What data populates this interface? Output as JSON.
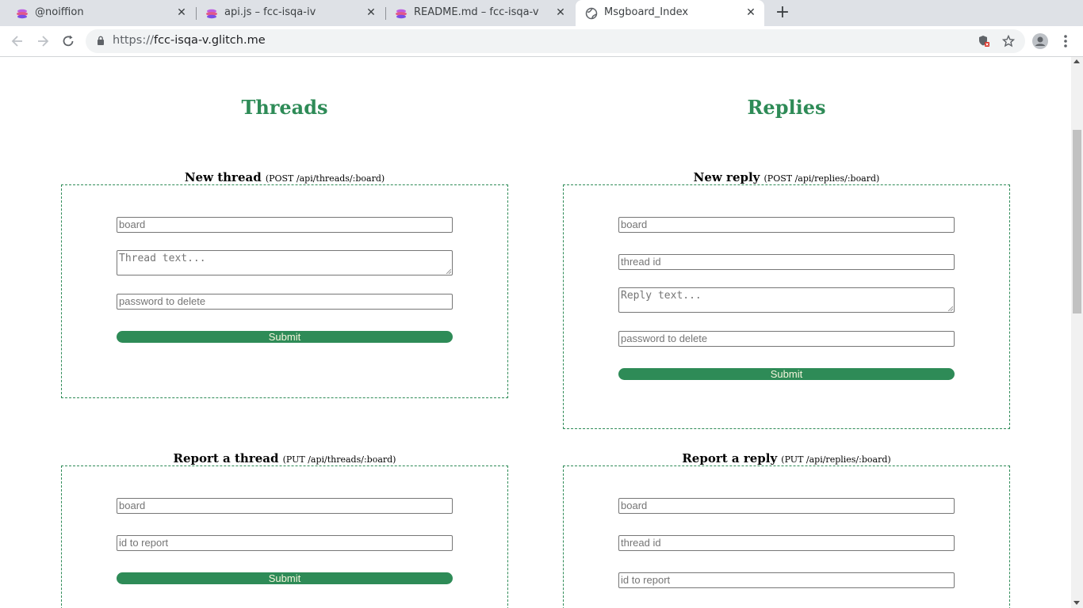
{
  "browser": {
    "tabs": [
      {
        "title": "@noiffion",
        "active": false
      },
      {
        "title": "api.js – fcc-isqa-iv",
        "active": false
      },
      {
        "title": "README.md – fcc-isqa-v",
        "active": false
      },
      {
        "title": "Msgboard_Index",
        "active": true
      }
    ],
    "url_scheme": "https://",
    "url_host": "fcc-isqa-v.glitch.me"
  },
  "page": {
    "accent_color": "#2e8b57",
    "threads_heading": "Threads",
    "replies_heading": "Replies",
    "new_thread": {
      "title": "New thread",
      "route": "(POST /api/threads/:board)",
      "board_placeholder": "board",
      "text_placeholder": "Thread text...",
      "password_placeholder": "password to delete",
      "submit_label": "Submit"
    },
    "new_reply": {
      "title": "New reply",
      "route": "(POST /api/replies/:board)",
      "board_placeholder": "board",
      "thread_id_placeholder": "thread id",
      "text_placeholder": "Reply text...",
      "password_placeholder": "password to delete",
      "submit_label": "Submit"
    },
    "report_thread": {
      "title": "Report a thread",
      "route": "(PUT /api/threads/:board)",
      "board_placeholder": "board",
      "id_placeholder": "id to report",
      "submit_label": "Submit"
    },
    "report_reply": {
      "title": "Report a reply",
      "route": "(PUT /api/replies/:board)",
      "board_placeholder": "board",
      "thread_id_placeholder": "thread id",
      "id_placeholder": "id to report"
    }
  }
}
